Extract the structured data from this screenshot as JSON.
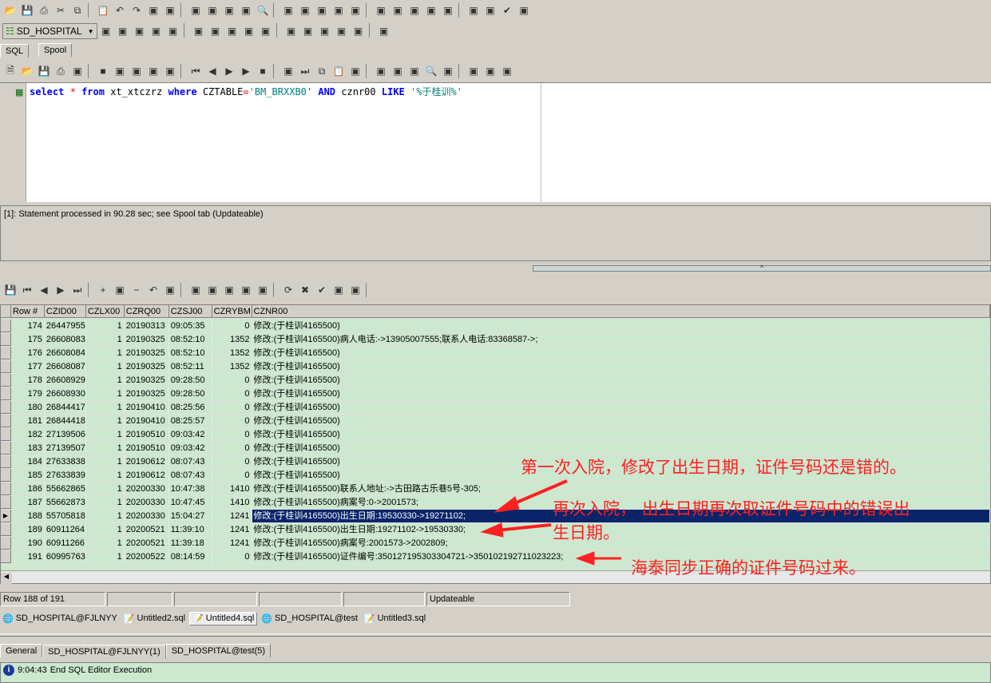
{
  "toolbar1_icons": [
    "open-icon",
    "save-icon",
    "print-icon",
    "cut-icon",
    "copy-icon",
    "paste-icon",
    "undo-icon",
    "redo-icon",
    "window-list-icon",
    "sort-asc-icon",
    "indent-icon",
    "outdent-icon",
    "comment-icon",
    "uncomment-icon",
    "find-icon",
    "replace-icon",
    "link-icon",
    "help-icon",
    "settings-icon",
    "spell-icon",
    "object-icon",
    "document-icon",
    "document-icon",
    "document-icon",
    "document-icon",
    "document-icon",
    "help-icon",
    "check-icon",
    "browser-icon"
  ],
  "connection": {
    "label": "SD_HOSPITAL"
  },
  "toolbar2_icons": [
    "describe-icon",
    "explain-icon",
    "xy-icon",
    "tools-icon",
    "tools-icon",
    "tools-icon",
    "tools-icon",
    "report-icon",
    "grid-icon",
    "grid-icon",
    "grid-icon",
    "grid-icon",
    "grid-icon",
    "tools-icon",
    "tools-icon",
    "window-icon"
  ],
  "editor_tabs": [
    "SQL",
    "Spool"
  ],
  "sql_toolbar_icons": [
    "new-icon",
    "open-icon",
    "save-icon",
    "print-icon",
    "execute-icon",
    "stop-icon",
    "step-icon",
    "format-icon",
    "link-icon",
    "explain-icon",
    "first-icon",
    "prev-icon",
    "play-icon",
    "next-icon",
    "stop-icon",
    "step-icon",
    "last-icon",
    "copy-icon",
    "paste-icon",
    "doc-icon",
    "doc-icon",
    "highlight-icon",
    "bookmark-icon",
    "find-icon",
    "replace-icon",
    "color-icon",
    "tool-icon",
    "grid-icon"
  ],
  "sql": {
    "select": "select",
    "star": "*",
    "from": "from",
    "table": "xt_xtczrz",
    "where": "where",
    "col": "CZTABLE",
    "eq": "=",
    "val": "'BM_BRXXB0'",
    "and": "AND",
    "col2": "cznr00",
    "like": "LIKE",
    "pat": "'%于桂训%'"
  },
  "message": "[1]: Statement processed in 90.28 sec; see Spool tab (Updateable)",
  "grid_toolbar_icons": [
    "save-icon",
    "first-icon",
    "prev-icon",
    "next-icon",
    "last-icon",
    "add-icon",
    "post-icon",
    "delete-icon",
    "undo-icon",
    "def-icon",
    "nd-icon",
    "d-icon",
    "n-icon",
    "grid-view-icon",
    "form-view-icon",
    "refresh-icon",
    "cancel-icon",
    "check-icon",
    "transfer-icon",
    "columns-icon"
  ],
  "columns": [
    "Row #",
    "CZID00",
    "CZLX00",
    "CZRQ00",
    "CZSJ00",
    "CZRYBM",
    "CZNR00"
  ],
  "rows": [
    [
      "174",
      "26447955",
      "1",
      "20190313",
      "09:05:35",
      "0",
      "修改:(于桂训4165500)"
    ],
    [
      "175",
      "26608083",
      "1",
      "20190325",
      "08:52:10",
      "1352",
      "修改:(于桂训4165500)病人电话:->13905007555;联系人电话:83368587->;"
    ],
    [
      "176",
      "26608084",
      "1",
      "20190325",
      "08:52:10",
      "1352",
      "修改:(于桂训4165500)"
    ],
    [
      "177",
      "26608087",
      "1",
      "20190325",
      "08:52:11",
      "1352",
      "修改:(于桂训4165500)"
    ],
    [
      "178",
      "26608929",
      "1",
      "20190325",
      "09:28:50",
      "0",
      "修改:(于桂训4165500)"
    ],
    [
      "179",
      "26608930",
      "1",
      "20190325",
      "09:28:50",
      "0",
      "修改:(于桂训4165500)"
    ],
    [
      "180",
      "26844417",
      "1",
      "20190410",
      "08:25:56",
      "0",
      "修改:(于桂训4165500)"
    ],
    [
      "181",
      "26844418",
      "1",
      "20190410",
      "08:25:57",
      "0",
      "修改:(于桂训4165500)"
    ],
    [
      "182",
      "27139506",
      "1",
      "20190510",
      "09:03:42",
      "0",
      "修改:(于桂训4165500)"
    ],
    [
      "183",
      "27139507",
      "1",
      "20190510",
      "09:03:42",
      "0",
      "修改:(于桂训4165500)"
    ],
    [
      "184",
      "27633838",
      "1",
      "20190612",
      "08:07:43",
      "0",
      "修改:(于桂训4165500)"
    ],
    [
      "185",
      "27633839",
      "1",
      "20190612",
      "08:07:43",
      "0",
      "修改:(于桂训4165500)"
    ],
    [
      "186",
      "55662865",
      "1",
      "20200330",
      "10:47:38",
      "1410",
      "修改:(于桂训4165500)联系人地址:->古田路古乐巷5号-305;"
    ],
    [
      "187",
      "55662873",
      "1",
      "20200330",
      "10:47:45",
      "1410",
      "修改:(于桂训4165500)病案号:0->2001573;"
    ],
    [
      "188",
      "55705818",
      "1",
      "20200330",
      "15:04:27",
      "1241",
      "修改:(于桂训4165500)出生日期:19530330->19271102;"
    ],
    [
      "189",
      "60911264",
      "1",
      "20200521",
      "11:39:10",
      "1241",
      "修改:(于桂训4165500)出生日期:19271102->19530330;"
    ],
    [
      "190",
      "60911266",
      "1",
      "20200521",
      "11:39:18",
      "1241",
      "修改:(于桂训4165500)病案号:2001573->2002809;"
    ],
    [
      "191",
      "60995763",
      "1",
      "20200522",
      "08:14:59",
      "0",
      "修改:(于桂训4165500)证件编号:350127195303304721->350102192711023223;"
    ]
  ],
  "selected_row": "188",
  "annotations": [
    "第一次入院，修改了出生日期，证件号码还是错的。",
    "再次入院，  出生日期再次取证件号码中的错误出",
    "生日期。",
    "海泰同步正确的证件号码过来。"
  ],
  "status": {
    "row_info": "Row 188 of 191",
    "mode": "Updateable"
  },
  "window_tabs": [
    "SD_HOSPITAL@FJLNYY",
    "Untitled2.sql",
    "Untitled4.sql",
    "SD_HOSPITAL@test",
    "Untitled3.sql"
  ],
  "bottom_tabs": [
    "General",
    "SD_HOSPITAL@FJLNYY(1)",
    "SD_HOSPITAL@test(5)"
  ],
  "output": {
    "time": "9:04:43",
    "text": "End SQL Editor Execution"
  },
  "colors": {
    "grid_bg": "#cce8cf",
    "selection": "#0a246a",
    "annotation": "#ff2020"
  }
}
